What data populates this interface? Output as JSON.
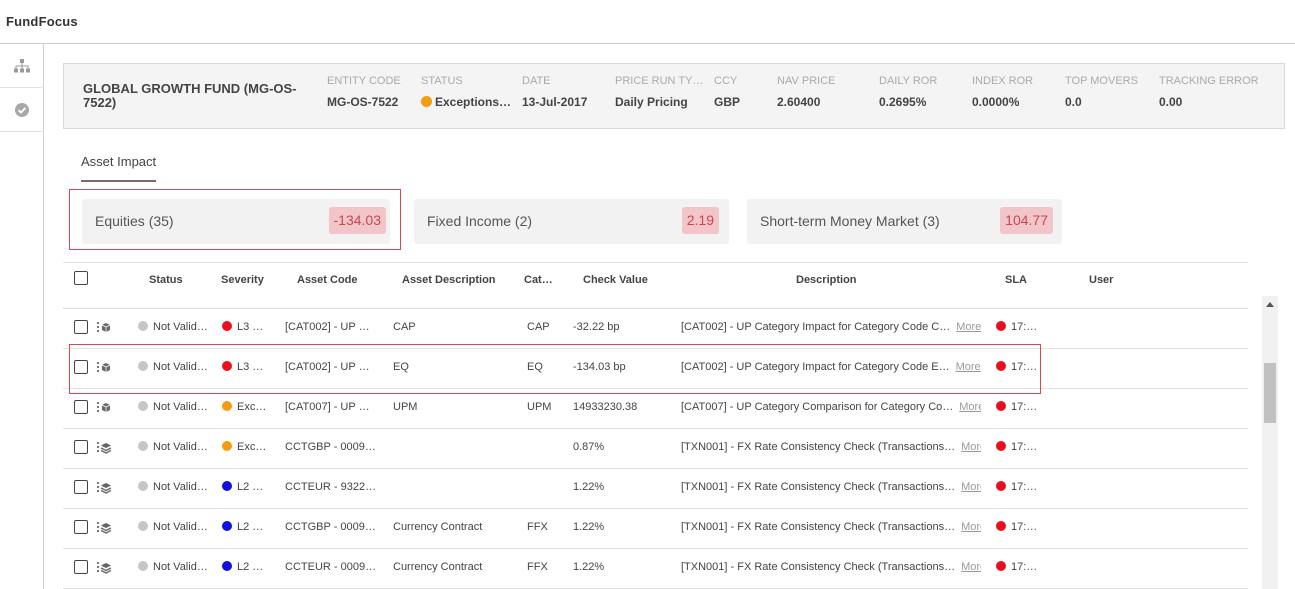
{
  "app": {
    "title": "FundFocus"
  },
  "fund": {
    "name": "GLOBAL GROWTH FUND (MG-OS-7522)",
    "fields": [
      {
        "label": "ENTITY CODE",
        "value": "MG-OS-7522"
      },
      {
        "label": "STATUS",
        "value": "Exceptions…",
        "dot_color": "#f59b12"
      },
      {
        "label": "DATE",
        "value": "13-Jul-2017"
      },
      {
        "label": "PRICE RUN TY…",
        "value": "Daily Pricing"
      },
      {
        "label": "CCY",
        "value": "GBP"
      },
      {
        "label": "NAV PRICE",
        "value": "2.60400"
      },
      {
        "label": "DAILY ROR",
        "value": "0.2695%"
      },
      {
        "label": "INDEX ROR",
        "value": "0.0000%"
      },
      {
        "label": "TOP MOVERS",
        "value": "0.0"
      },
      {
        "label": "TRACKING ERROR",
        "value": "0.00"
      }
    ]
  },
  "tabs": {
    "asset_impact": "Asset Impact"
  },
  "categories": [
    {
      "label": "Equities (35)",
      "value": "-134.03"
    },
    {
      "label": "Fixed Income (2)",
      "value": "2.19"
    },
    {
      "label": "Short-term Money Market (3)",
      "value": "104.77"
    }
  ],
  "table": {
    "headers": {
      "status": "Status",
      "severity": "Severity",
      "asset_code": "Asset Code",
      "asset_description": "Asset Description",
      "category": "Cat…",
      "check_value": "Check Value",
      "description": "Description",
      "sla": "SLA",
      "user": "User"
    },
    "more_label": "More",
    "rows": [
      {
        "icon": "cube-icon",
        "status": "Not Valid…",
        "severity_color": "#e8101c",
        "severity": "L3 …",
        "asset_code": "[CAT002] - UP …",
        "asset_description": "CAP",
        "category": "CAP",
        "check_value": "-32.22 bp",
        "description": "[CAT002] - UP Category Impact for Category Code C…",
        "sla": "17:…",
        "user": ""
      },
      {
        "icon": "cube-icon",
        "status": "Not Valid…",
        "severity_color": "#e8101c",
        "severity": "L3 …",
        "asset_code": "[CAT002] - UP …",
        "asset_description": "EQ",
        "category": "EQ",
        "check_value": "-134.03 bp",
        "description": "[CAT002] - UP Category Impact for Category Code E…",
        "sla": "17:…",
        "user": ""
      },
      {
        "icon": "cube-icon",
        "status": "Not Valid…",
        "severity_color": "#f59b12",
        "severity": "Exc…",
        "asset_code": "[CAT007] - UP …",
        "asset_description": "UPM",
        "category": "UPM",
        "check_value": "14933230.38",
        "description": "[CAT007] - UP Category Comparison for Category Co…",
        "sla": "17:…",
        "user": ""
      },
      {
        "icon": "layers-icon",
        "status": "Not Valid…",
        "severity_color": "#f59b12",
        "severity": "Exc…",
        "asset_code": "CCTGBP - 0009…",
        "asset_description": "",
        "category": "",
        "check_value": "0.87%",
        "description": "[TXN001] - FX Rate Consistency Check (Transactions…",
        "sla": "17:…",
        "user": ""
      },
      {
        "icon": "layers-icon",
        "status": "Not Valid…",
        "severity_color": "#1010e0",
        "severity": "L2 …",
        "asset_code": "CCTEUR - 9322…",
        "asset_description": "",
        "category": "",
        "check_value": "1.22%",
        "description": "[TXN001] - FX Rate Consistency Check (Transactions…",
        "sla": "17:…",
        "user": ""
      },
      {
        "icon": "layers-icon",
        "status": "Not Valid…",
        "severity_color": "#1010e0",
        "severity": "L2 …",
        "asset_code": "CCTGBP - 0009…",
        "asset_description": "Currency Contract",
        "category": "FFX",
        "check_value": "1.22%",
        "description": "[TXN001] - FX Rate Consistency Check (Transactions…",
        "sla": "17:…",
        "user": ""
      },
      {
        "icon": "layers-icon",
        "status": "Not Valid…",
        "severity_color": "#1010e0",
        "severity": "L2 …",
        "asset_code": "CCTEUR - 0009…",
        "asset_description": "Currency Contract",
        "category": "FFX",
        "check_value": "1.22%",
        "description": "[TXN001] - FX Rate Consistency Check (Transactions…",
        "sla": "17:…",
        "user": ""
      }
    ]
  },
  "colors": {
    "status_dot": "#c6c6c6",
    "sla_dot": "#e8101c",
    "highlight_border": "#e0464f",
    "badge_bg": "#f2c6c9",
    "badge_text": "#c8474f"
  }
}
